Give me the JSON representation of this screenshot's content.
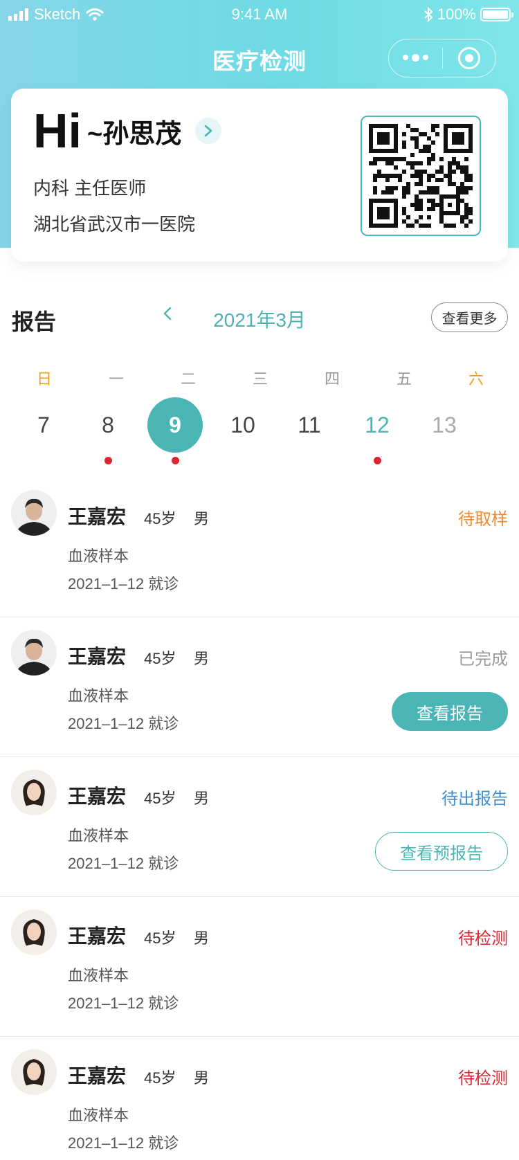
{
  "status_bar": {
    "carrier": "Sketch",
    "time": "9:41 AM",
    "battery": "100%"
  },
  "nav": {
    "title": "医疗检测"
  },
  "profile": {
    "greeting": "Hi",
    "name": "~孙思茂",
    "department": "内科 主任医师",
    "hospital": "湖北省武汉市一医院"
  },
  "report": {
    "title": "报告",
    "month": "2021年3月",
    "more_label": "查看更多"
  },
  "calendar": {
    "weekdays": [
      "日",
      "一",
      "二",
      "三",
      "四",
      "五",
      "六"
    ],
    "weekend_color": "#f0a21d",
    "dates": [
      "7",
      "8",
      "9",
      "10",
      "11",
      "12",
      "13"
    ],
    "selected": "9",
    "has_records": [
      "8",
      "9",
      "12"
    ]
  },
  "patients": [
    {
      "name": "王嘉宏",
      "age": "45岁",
      "sex": "男",
      "sample": "血液样本",
      "visit": "2021–1–12 就诊",
      "status": "待取样",
      "status_color": "#f08a2c",
      "action": ""
    },
    {
      "name": "王嘉宏",
      "age": "45岁",
      "sex": "男",
      "sample": "血液样本",
      "visit": "2021–1–12 就诊",
      "status": "已完成",
      "status_color": "#9a9a9a",
      "action": "查看报告"
    },
    {
      "name": "王嘉宏",
      "age": "45岁",
      "sex": "男",
      "sample": "血液样本",
      "visit": "2021–1–12 就诊",
      "status": "待出报告",
      "status_color": "#3c8fd6",
      "action": "查看预报告"
    },
    {
      "name": "王嘉宏",
      "age": "45岁",
      "sex": "男",
      "sample": "血液样本",
      "visit": "2021–1–12 就诊",
      "status": "待检测",
      "status_color": "#d9262f",
      "action": ""
    },
    {
      "name": "王嘉宏",
      "age": "45岁",
      "sex": "男",
      "sample": "血液样本",
      "visit": "2021–1–12 就诊",
      "status": "待检测",
      "status_color": "#d9262f",
      "action": ""
    }
  ],
  "colors": {
    "accent": "#4bb4b5",
    "dot": "#d9262f"
  }
}
